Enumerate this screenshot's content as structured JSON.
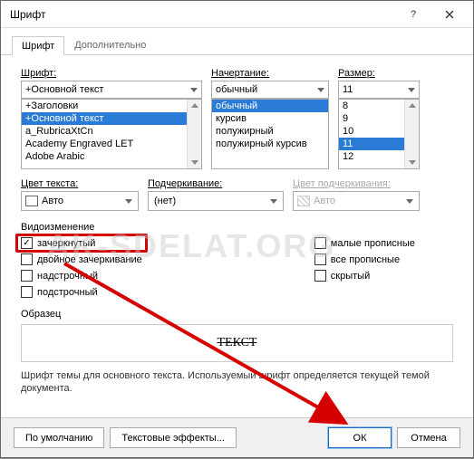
{
  "title": "Шрифт",
  "tabs": {
    "font": "Шрифт",
    "advanced": "Дополнительно"
  },
  "labels": {
    "font": "Шрифт:",
    "style": "Начертание:",
    "size": "Размер:",
    "color": "Цвет текста:",
    "underline": "Подчеркивание:",
    "ulcolor": "Цвет подчеркивания:",
    "effects": "Видоизменение",
    "sample": "Образец"
  },
  "font": {
    "value": "+Основной текст",
    "items": [
      "+Заголовки",
      "+Основной текст",
      "a_RubricaXtCn",
      "Academy Engraved LET",
      "Adobe Arabic"
    ],
    "selectedIndex": 1
  },
  "style": {
    "value": "обычный",
    "items": [
      "обычный",
      "курсив",
      "полужирный",
      "полужирный курсив"
    ],
    "selectedIndex": 0
  },
  "size": {
    "value": "11",
    "items": [
      "8",
      "9",
      "10",
      "11",
      "12"
    ],
    "selectedIndex": 3
  },
  "color": {
    "value": "Авто"
  },
  "underline": {
    "value": "(нет)"
  },
  "ulcolor": {
    "value": "Авто"
  },
  "checks": {
    "strike": "зачеркнутый",
    "dstrike": "двойное зачеркивание",
    "superscript": "надстрочный",
    "subscript": "подстрочный",
    "smallcaps": "малые прописные",
    "allcaps": "все прописные",
    "hidden": "скрытый"
  },
  "checked": {
    "strike": true
  },
  "preview": "ТЕКСТ",
  "desc": "Шрифт темы для основного текста. Используемый шрифт определяется текущей темой документа.",
  "buttons": {
    "default": "По умолчанию",
    "effects": "Текстовые эффекты...",
    "ok": "ОК",
    "cancel": "Отмена"
  }
}
